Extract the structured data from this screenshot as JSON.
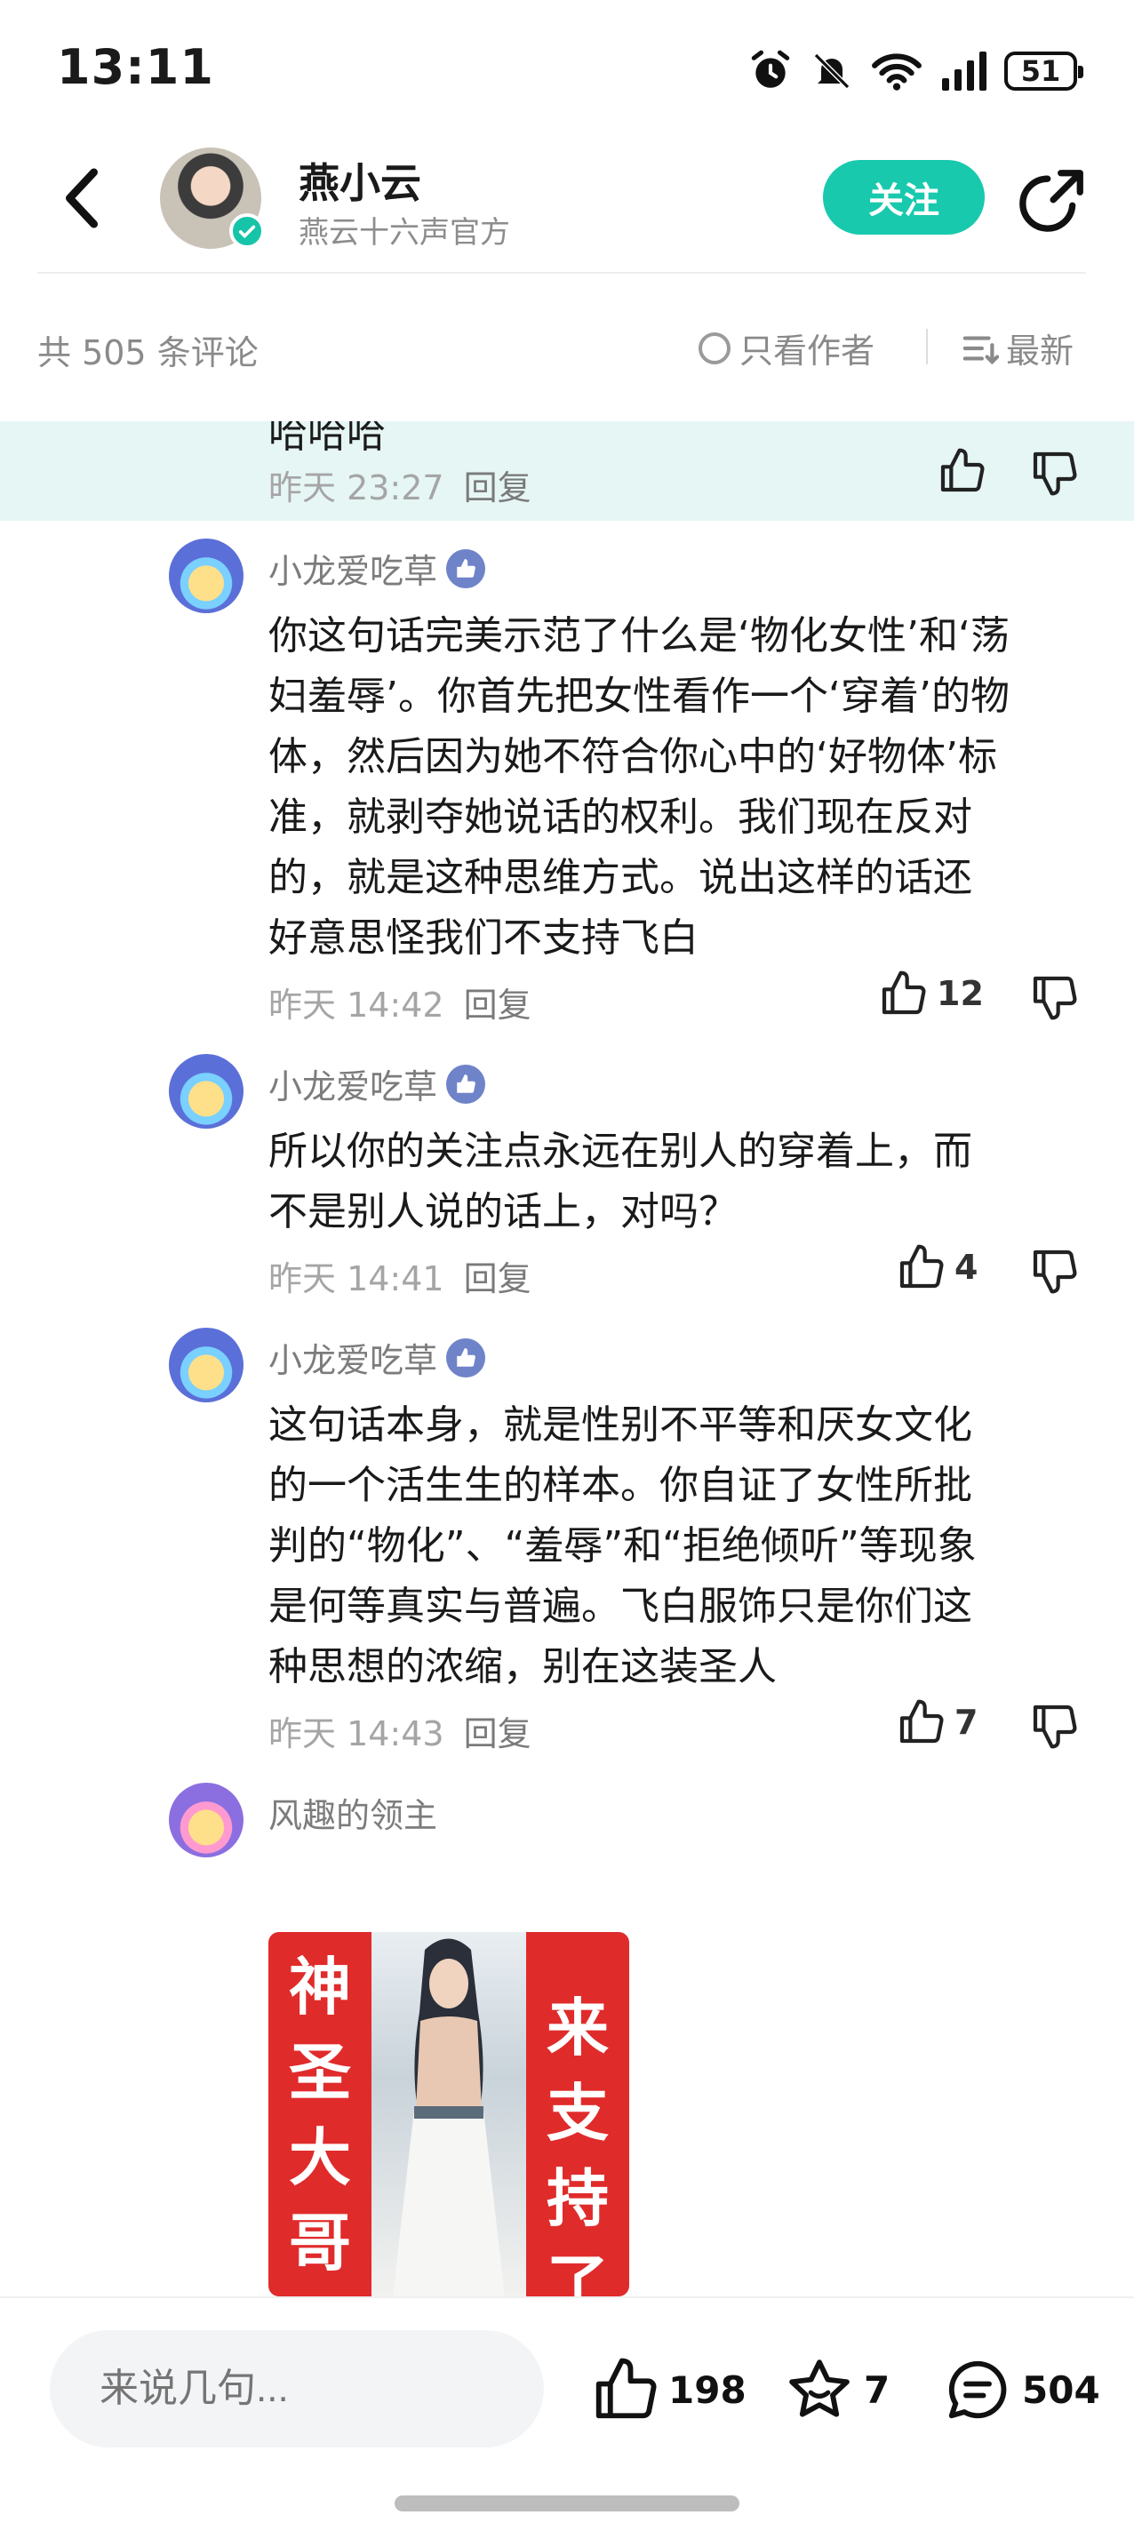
{
  "status_bar": {
    "time": "13:11",
    "battery": "51"
  },
  "header": {
    "user_name": "燕小云",
    "user_subtitle": "燕云十六声官方",
    "follow_label": "关注"
  },
  "comment_bar": {
    "count_text": "共 505 条评论",
    "author_only_label": "只看作者",
    "sort_label": "最新"
  },
  "highlighted": {
    "partial_text": "哈哈哈",
    "time": "昨天 23:27",
    "reply_label": "回复"
  },
  "comments": [
    {
      "user": "小龙爱吃草",
      "text_lines": [
        "你这句话完美示范了什么是‘物化女性’和‘荡",
        "妇羞辱’。你首先把女性看作一个‘穿着’的物",
        "体，然后因为她不符合你心中的‘好物体’标",
        "准，就剥夺她说话的权利。我们现在反对",
        "的，就是这种思维方式。说出这样的话还",
        "好意思怪我们不支持飞白"
      ],
      "time": "昨天 14:42",
      "reply_label": "回复",
      "likes": "12"
    },
    {
      "user": "小龙爱吃草",
      "text_lines": [
        "所以你的关注点永远在别人的穿着上，而",
        "不是别人说的话上，对吗？"
      ],
      "time": "昨天 14:41",
      "reply_label": "回复",
      "likes": "4"
    },
    {
      "user": "小龙爱吃草",
      "text_lines": [
        "这句话本身，就是性别不平等和厌女文化",
        "的一个活生生的样本。你自证了女性所批",
        "判的“物化”、“羞辱”和“拒绝倾听”等现象",
        "是何等真实与普遍。飞白服饰只是你们这",
        "种思想的浓缩，别在这装圣人"
      ],
      "time": "昨天 14:43",
      "reply_label": "回复",
      "likes": "7"
    },
    {
      "user": "风趣的领主",
      "image_left_text": [
        "神",
        "圣",
        "大",
        "哥"
      ],
      "image_right_text": [
        "来",
        "支",
        "持",
        "了"
      ]
    }
  ],
  "bottom_bar": {
    "input_placeholder": "来说几句...",
    "like_count": "198",
    "favorite_count": "7",
    "comment_count": "504"
  },
  "colors": {
    "accent": "#18c9ad",
    "highlight_bg": "#e6f6f5",
    "badge": "#6f83c9"
  }
}
